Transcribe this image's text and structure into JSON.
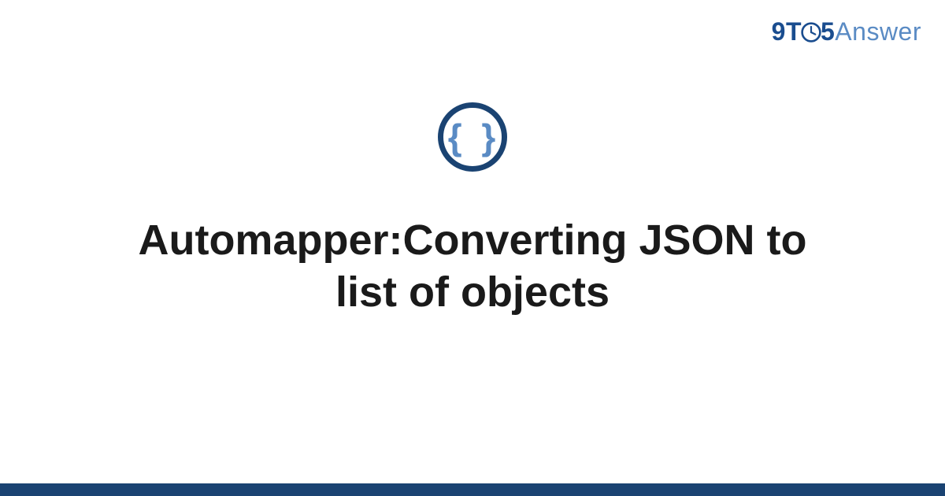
{
  "brand": {
    "part1": "9",
    "part2": "T",
    "part3": "5",
    "part4": "Answer"
  },
  "main": {
    "title": "Automapper:Converting JSON to list of objects",
    "icon_name": "json-braces-icon"
  },
  "colors": {
    "brand_dark": "#1a4d8f",
    "brand_light": "#5a8bc4",
    "icon_ring": "#1a4372",
    "footer_bar": "#1a4372"
  }
}
